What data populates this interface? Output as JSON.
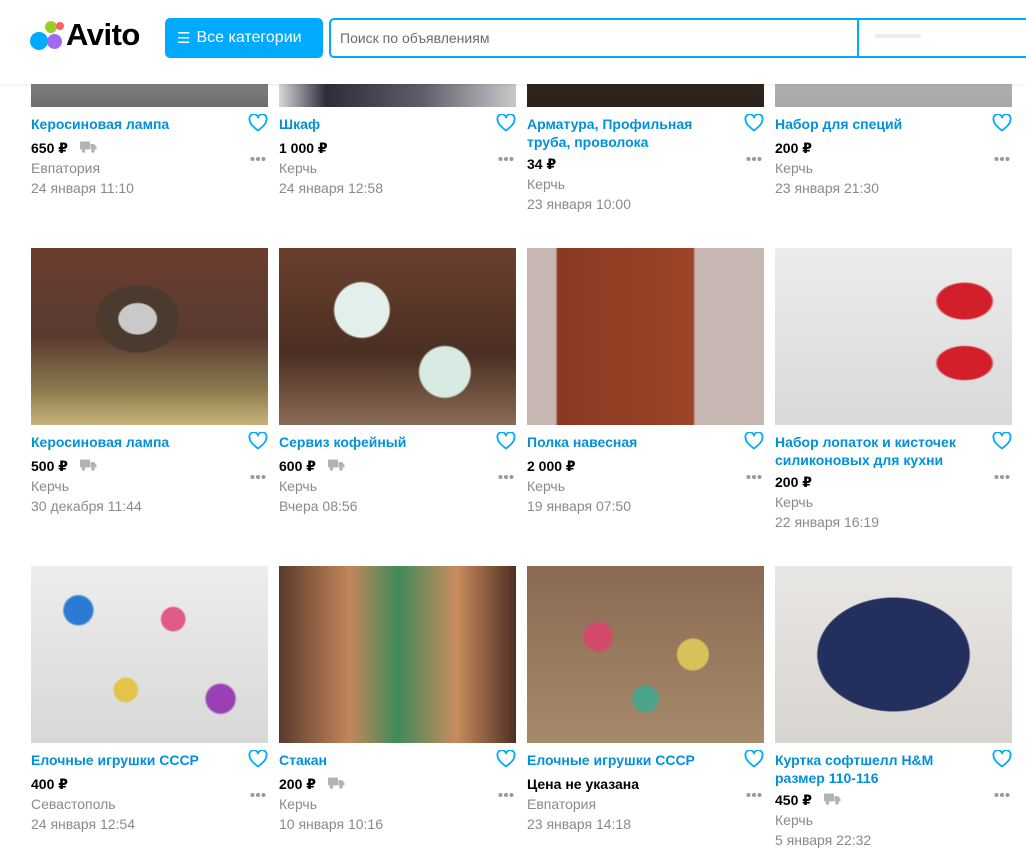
{
  "header": {
    "logo_text": "Avito",
    "categories_label": "Все категории",
    "search_placeholder": "Поиск по объявлениям",
    "accent_color": "#00aaff"
  },
  "listings": [
    {
      "title": "Керосиновая лампа",
      "price": "650 ₽",
      "delivery": true,
      "city": "Евпатория",
      "date": "24 января 11:10"
    },
    {
      "title": "Шкаф",
      "price": "1 000 ₽",
      "delivery": false,
      "city": "Керчь",
      "date": "24 января 12:58"
    },
    {
      "title": "Арматура, Профильная труба, проволока",
      "price": "34 ₽",
      "delivery": false,
      "city": "Керчь",
      "date": "23 января 10:00"
    },
    {
      "title": "Набор для специй",
      "price": "200 ₽",
      "delivery": false,
      "city": "Керчь",
      "date": "23 января 21:30"
    },
    {
      "title": "Керосиновая лампа",
      "price": "500 ₽",
      "delivery": true,
      "city": "Керчь",
      "date": "30 декабря 11:44"
    },
    {
      "title": "Сервиз кофейный",
      "price": "600 ₽",
      "delivery": true,
      "city": "Керчь",
      "date": "Вчера 08:56"
    },
    {
      "title": "Полка навесная",
      "price": "2 000 ₽",
      "delivery": false,
      "city": "Керчь",
      "date": "19 января 07:50"
    },
    {
      "title": "Набор лопаток и кисточек силиконовых для кухни",
      "price": "200 ₽",
      "delivery": false,
      "city": "Керчь",
      "date": "22 января 16:19"
    },
    {
      "title": "Елочные игрушки СССР",
      "price": "400 ₽",
      "delivery": false,
      "city": "Севастополь",
      "date": "24 января 12:54"
    },
    {
      "title": "Стакан",
      "price": "200 ₽",
      "delivery": true,
      "city": "Керчь",
      "date": "10 января 10:16"
    },
    {
      "title": "Елочные игрушки СССР",
      "price": "Цена не указана",
      "delivery": false,
      "city": "Евпатория",
      "date": "23 января 14:18"
    },
    {
      "title": "Куртка софтшелл H&M размер 110-116",
      "price": "450 ₽",
      "delivery": true,
      "city": "Керчь",
      "date": "5 января 22:32"
    }
  ]
}
